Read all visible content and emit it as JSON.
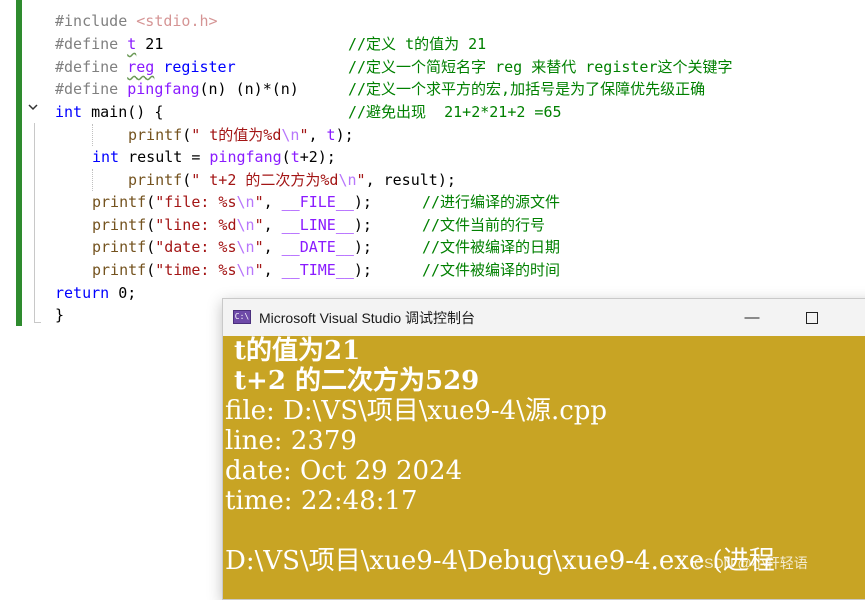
{
  "editor": {
    "lines": {
      "l1": {
        "kw": "#include ",
        "str": "<stdio.h>"
      },
      "l2": {
        "kw": "#define ",
        "name": "t",
        "val": " 21",
        "cmt": "//定义 t的值为 21"
      },
      "l3": {
        "kw": "#define ",
        "name": "reg",
        "sp": " ",
        "val": "register",
        "cmt": "//定义一个简短名字 reg 来替代 register这个关键字"
      },
      "l4": {
        "kw": "#define ",
        "name": "pingfang",
        "val": "(n) (n)*(n)",
        "cmt": "//定义一个求平方的宏,加括号是为了保障优先级正确"
      },
      "l5": {
        "kw": "int",
        "rest": " main() {",
        "cmt": "//避免出现  21+2*21+2 =65"
      },
      "l6": {
        "fn": "printf",
        "a": "(",
        "str1": "\" t的值为%d",
        "esc": "\\n",
        "str2": "\"",
        "b": ", ",
        "var": "t",
        "c": ");"
      },
      "l7": {
        "kw": "int",
        "a": " result = ",
        "mac": "pingfang",
        "b": "(",
        "var": "t",
        "c": "+",
        "num": "2",
        "d": ");"
      },
      "l8": {
        "fn": "printf",
        "a": "(",
        "str1": "\" t+2 的二次方为%d",
        "esc": "\\n",
        "str2": "\"",
        "b": ", ",
        "var": "result",
        "c": ");"
      },
      "l9": {
        "fn": "printf",
        "a": "(",
        "str1": "\"file: %s",
        "esc": "\\n",
        "str2": "\"",
        "b": ", ",
        "mac": "__FILE__",
        "c": ");",
        "cmt": "//进行编译的源文件"
      },
      "l10": {
        "fn": "printf",
        "a": "(",
        "str1": "\"line: %d",
        "esc": "\\n",
        "str2": "\"",
        "b": ", ",
        "mac": "__LINE__",
        "c": ");",
        "cmt": "//文件当前的行号"
      },
      "l11": {
        "fn": "printf",
        "a": "(",
        "str1": "\"date: %s",
        "esc": "\\n",
        "str2": "\"",
        "b": ", ",
        "mac": "__DATE__",
        "c": ");",
        "cmt": "//文件被编译的日期"
      },
      "l12": {
        "fn": "printf",
        "a": "(",
        "str1": "\"time: %s",
        "esc": "\\n",
        "str2": "\"",
        "b": ", ",
        "mac": "__TIME__",
        "c": ");",
        "cmt": "//文件被编译的时间"
      },
      "l13": {
        "kw": "return",
        "rest": " 0;"
      },
      "l14": {
        "rest": "}"
      }
    },
    "fold_icon": "chevron-down-icon"
  },
  "console": {
    "title": "Microsoft Visual Studio 调试控制台",
    "icon_label": "C:\\",
    "minimize": "—",
    "close": "✕",
    "output": [
      " t的值为21",
      " t+2 的二次方为529",
      "file: D:\\VS\\项目\\xue9-4\\源.cpp",
      "line: 2379",
      "date: Oct 29 2024",
      "time: 22:48:17",
      "",
      "D:\\VS\\项目\\xue9-4\\Debug\\xue9-4.exe (进程"
    ],
    "background": "#c8a424"
  },
  "watermark": "CSDN @小轩轻语"
}
